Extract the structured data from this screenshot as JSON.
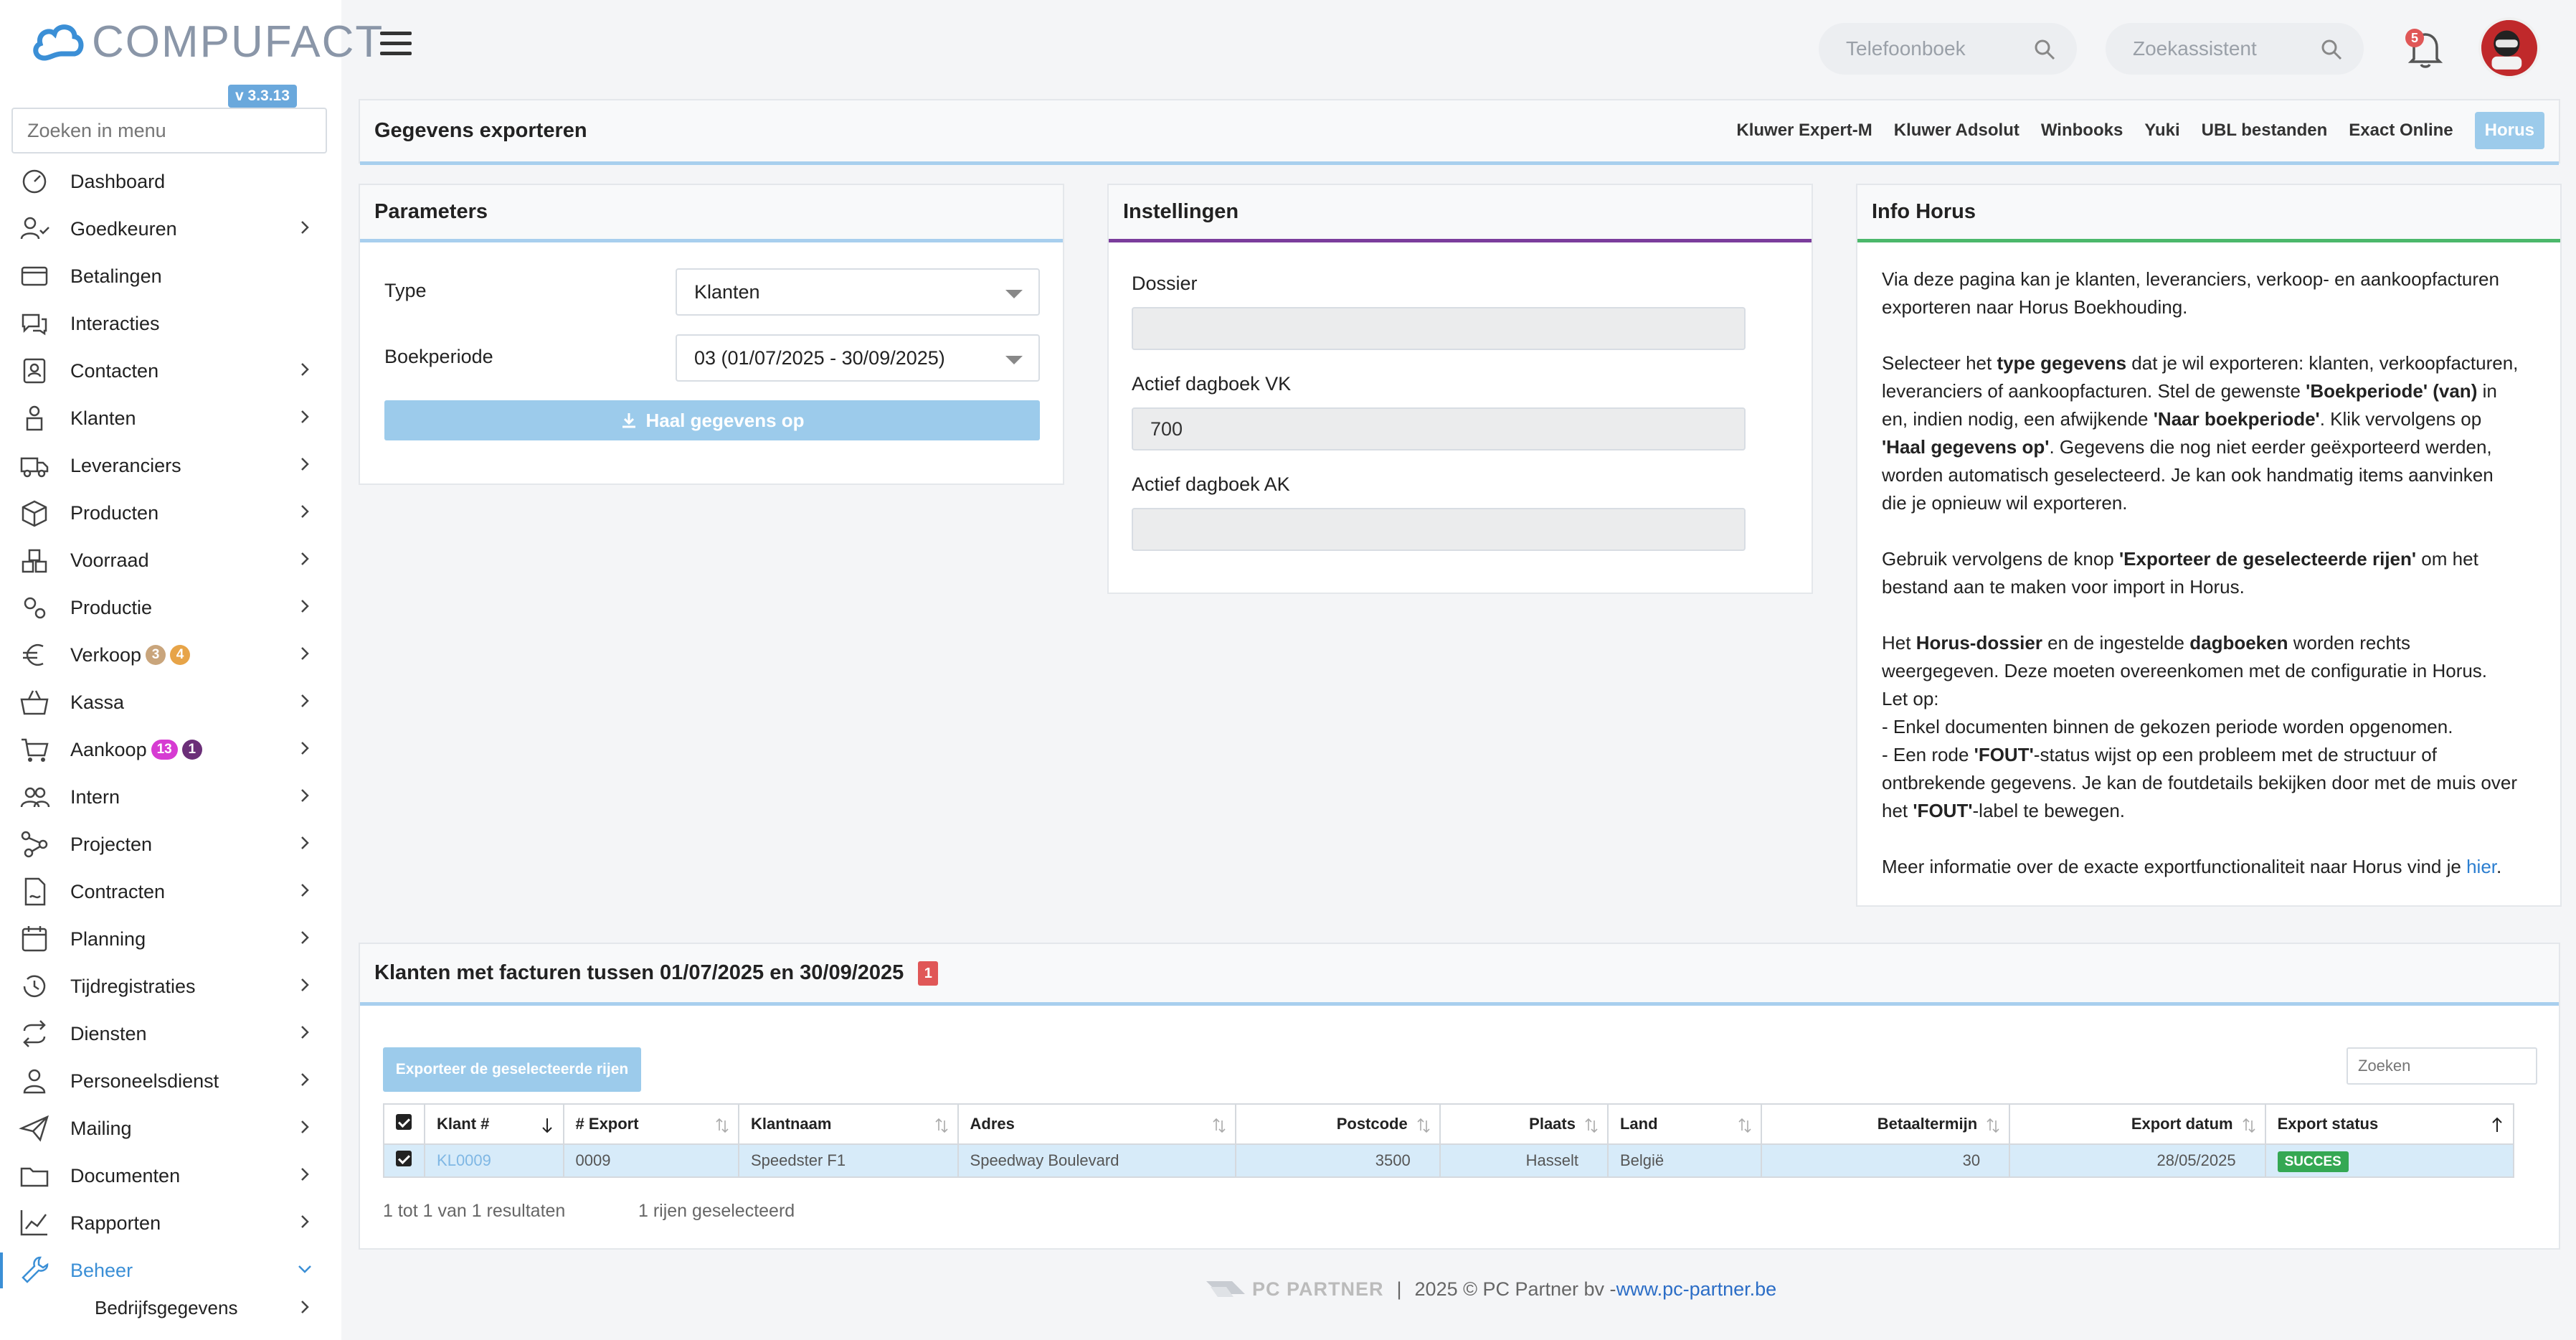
{
  "app": {
    "logo_text": "COMPUFACT",
    "version": "v 3.3.13"
  },
  "sidebar": {
    "search_placeholder": "Zoeken in menu",
    "items": [
      {
        "label": "Dashboard",
        "icon": "dashboard-icon",
        "chevron": false
      },
      {
        "label": "Goedkeuren",
        "icon": "user-check-icon",
        "chevron": true
      },
      {
        "label": "Betalingen",
        "icon": "credit-card-icon",
        "chevron": false
      },
      {
        "label": "Interacties",
        "icon": "chat-icon",
        "chevron": false
      },
      {
        "label": "Contacten",
        "icon": "address-book-icon",
        "chevron": true
      },
      {
        "label": "Klanten",
        "icon": "customer-icon",
        "chevron": true
      },
      {
        "label": "Leveranciers",
        "icon": "truck-icon",
        "chevron": true
      },
      {
        "label": "Producten",
        "icon": "box-icon",
        "chevron": true
      },
      {
        "label": "Voorraad",
        "icon": "stock-icon",
        "chevron": true
      },
      {
        "label": "Productie",
        "icon": "cogs-icon",
        "chevron": true
      },
      {
        "label": "Verkoop",
        "icon": "euro-icon",
        "chevron": true,
        "badges": [
          {
            "text": "3",
            "color": "#c9a57c"
          },
          {
            "text": "4",
            "color": "#e7a448"
          }
        ]
      },
      {
        "label": "Kassa",
        "icon": "basket-icon",
        "chevron": true
      },
      {
        "label": "Aankoop",
        "icon": "cart-icon",
        "chevron": true,
        "badges": [
          {
            "text": "13",
            "color": "#d63bd2"
          },
          {
            "text": "1",
            "color": "#6b2f78"
          }
        ]
      },
      {
        "label": "Intern",
        "icon": "users-icon",
        "chevron": true
      },
      {
        "label": "Projecten",
        "icon": "project-icon",
        "chevron": true
      },
      {
        "label": "Contracten",
        "icon": "contract-icon",
        "chevron": true
      },
      {
        "label": "Planning",
        "icon": "calendar-icon",
        "chevron": true
      },
      {
        "label": "Tijdregistraties",
        "icon": "history-icon",
        "chevron": true
      },
      {
        "label": "Diensten",
        "icon": "repeat-icon",
        "chevron": true
      },
      {
        "label": "Personeelsdienst",
        "icon": "person-badge-icon",
        "chevron": true
      },
      {
        "label": "Mailing",
        "icon": "paper-plane-icon",
        "chevron": true
      },
      {
        "label": "Documenten",
        "icon": "folder-icon",
        "chevron": true
      },
      {
        "label": "Rapporten",
        "icon": "chart-line-icon",
        "chevron": true
      },
      {
        "label": "Beheer",
        "icon": "wrench-icon",
        "chevron": true,
        "active": true
      }
    ],
    "sub_item": "Bedrijfsgegevens"
  },
  "topbar": {
    "phonebook_placeholder": "Telefoonboek",
    "assistant_placeholder": "Zoekassistent",
    "notifications": "5"
  },
  "export_panel": {
    "title": "Gegevens exporteren",
    "tabs": [
      "Kluwer Expert-M",
      "Kluwer Adsolut",
      "Winbooks",
      "Yuki",
      "UBL bestanden",
      "Exact Online",
      "Horus"
    ],
    "active_tab": "Horus"
  },
  "parameters": {
    "title": "Parameters",
    "type_label": "Type",
    "type_value": "Klanten",
    "period_label": "Boekperiode",
    "period_value": "03 (01/07/2025 - 30/09/2025)",
    "fetch_button": "Haal gegevens op"
  },
  "settings": {
    "title": "Instellingen",
    "dossier_label": "Dossier",
    "dossier_value": "",
    "vk_label": "Actief dagboek VK",
    "vk_value": "700",
    "ak_label": "Actief dagboek AK",
    "ak_value": ""
  },
  "info": {
    "title": "Info Horus",
    "p1": "Via deze pagina kan je klanten, leveranciers, verkoop- en aankoopfacturen exporteren naar Horus Boekhouding.",
    "p2_a": "Selecteer het ",
    "p2_b": "type gegevens",
    "p2_c": " dat je wil exporteren: klanten, verkoopfacturen, leveranciers of aankoopfacturen. Stel de gewenste ",
    "p2_d": "'Boekperiode' (van)",
    "p2_e": " in en, indien nodig, een afwijkende ",
    "p2_f": "'Naar boekperiode'",
    "p2_g": ". Klik vervolgens op ",
    "p2_h": "'Haal gegevens op'",
    "p2_i": ". Gegevens die nog niet eerder geëxporteerd werden, worden automatisch geselecteerd. Je kan ook handmatig items aanvinken die je opnieuw wil exporteren.",
    "p3_a": "Gebruik vervolgens de knop ",
    "p3_b": "'Exporteer de geselecteerde rijen'",
    "p3_c": " om het bestand aan te maken voor import in Horus.",
    "p4_a": "Het ",
    "p4_b": "Horus-dossier",
    "p4_c": " en de ingestelde ",
    "p4_d": "dagboeken",
    "p4_e": " worden rechts weergegeven. Deze moeten overeenkomen met de configuratie in Horus.",
    "p4_f": "Let op:",
    "p4_g": "- Enkel documenten binnen de gekozen periode worden opgenomen.",
    "p4_h": "- Een rode ",
    "p4_i": "'FOUT'",
    "p4_j": "-status wijst op een probleem met de structuur of ontbrekende gegevens. Je kan de foutdetails bekijken door met de muis over het ",
    "p4_k": "'FOUT'",
    "p4_l": "-label te bewegen.",
    "p5_a": "Meer informatie over de exacte exportfunctionaliteit naar Horus vind je ",
    "p5_link": "hier",
    "p5_b": "."
  },
  "results": {
    "title": "Klanten met facturen tussen 01/07/2025 en 30/09/2025",
    "count_badge": "1",
    "export_button": "Exporteer de geselecteerde rijen",
    "search_placeholder": "Zoeken",
    "columns": [
      "Klant #",
      "# Export",
      "Klantnaam",
      "Adres",
      "Postcode",
      "Plaats",
      "Land",
      "Betaaltermijn",
      "Export datum",
      "Export status"
    ],
    "rows": [
      {
        "klant": "KL0009",
        "export": "0009",
        "naam": "Speedster F1",
        "adres": "Speedway Boulevard",
        "postcode": "3500",
        "plaats": "Hasselt",
        "land": "België",
        "termijn": "30",
        "datum": "28/05/2025",
        "status": "SUCCES"
      }
    ],
    "summary": "1 tot 1 van 1 resultaten",
    "selected": "1 rijen geselecteerd"
  },
  "footer": {
    "brand": "PC PARTNER",
    "sep": "|",
    "copyright": "2025 © PC Partner bv - ",
    "link": "www.pc-partner.be"
  }
}
